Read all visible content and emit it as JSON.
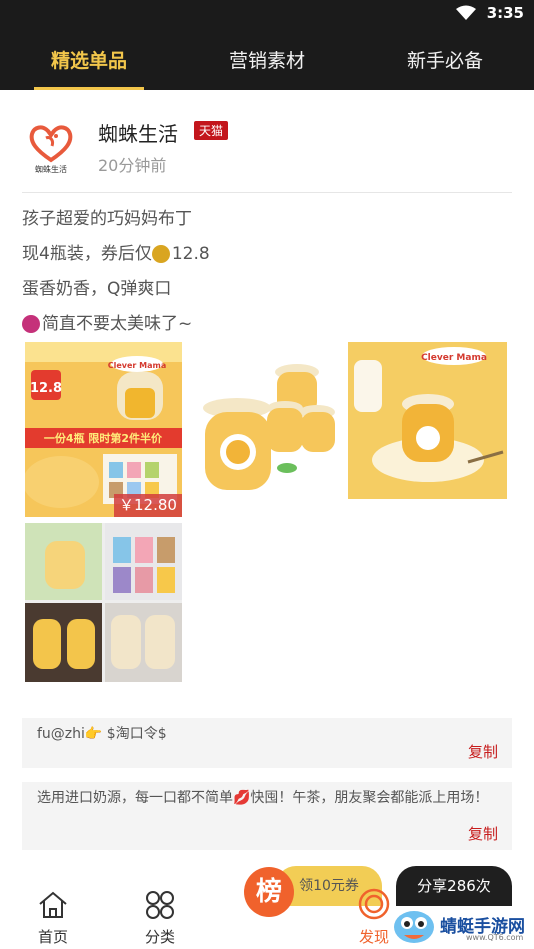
{
  "status_bar": {
    "time": "3:35"
  },
  "tabs": [
    {
      "label": "精选单品",
      "active": true
    },
    {
      "label": "营销素材",
      "active": false
    },
    {
      "label": "新手必备",
      "active": false
    }
  ],
  "shop": {
    "name": "蜘蛛生活",
    "logo_text": "蜘蛛生活",
    "badge": "天猫",
    "time": "20分钟前"
  },
  "description": {
    "line1": "孩子超爱的巧妈妈布丁",
    "line2": "现4瓶装，券后仅",
    "line2_price": "12.8",
    "line3": "蛋香奶香，Q弹爽口",
    "line4": "简直不要太美味了~"
  },
  "product_images": {
    "img1_brand": "Clever Mama",
    "img1_price_label": "12.8",
    "img1_promo": "一份4瓶  限时第2件半价",
    "img3_brand": "Clever Mama",
    "price_tag": "￥12.80"
  },
  "copy_boxes": [
    {
      "text": "fu@zhi👉 $淘口令$",
      "button": "复制"
    },
    {
      "text": "选用进口奶源，每一口都不简单💋快囤！午茶，朋友聚会都能派上用场！",
      "button": "复制"
    }
  ],
  "actions": {
    "coupon": "领10元券",
    "share": "分享286次"
  },
  "bottom_nav": {
    "home": "首页",
    "category": "分类",
    "rank": "榜",
    "find": "发现"
  },
  "watermark": {
    "text": "蜻蜓手游网",
    "url": "www.QT6.com"
  },
  "colors": {
    "accent": "#f2c64b",
    "dark": "#1b1b1b",
    "red": "#c71c1c",
    "orange": "#f0622c"
  }
}
